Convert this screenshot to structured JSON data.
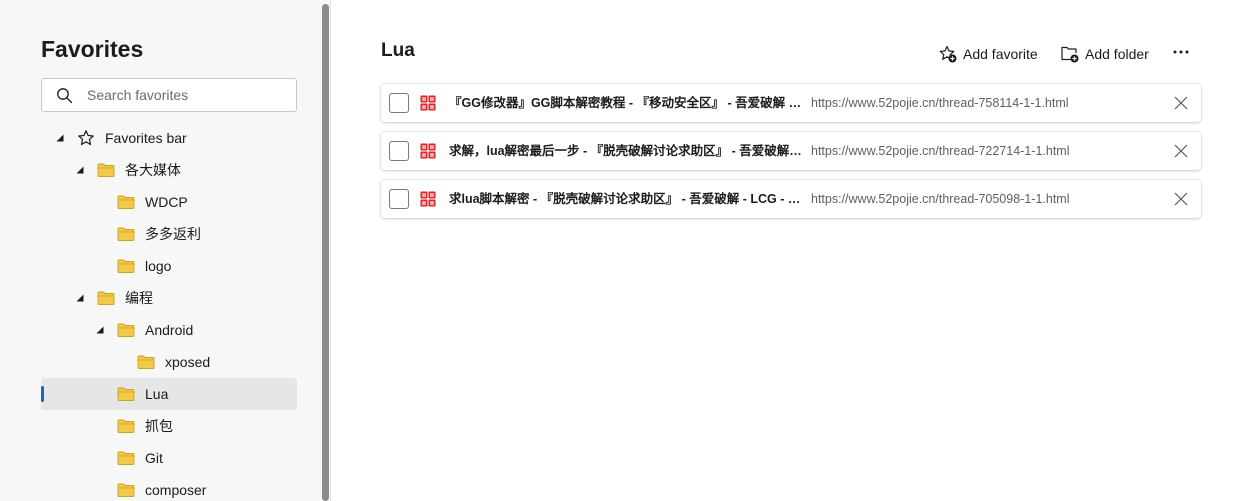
{
  "sidebar": {
    "title": "Favorites",
    "search": {
      "placeholder": "Search favorites",
      "value": ""
    },
    "tree": [
      {
        "label": "Favorites bar",
        "icon": "star-icon",
        "expanded": true,
        "depth": 0
      },
      {
        "label": "各大媒体",
        "icon": "folder-icon",
        "expanded": true,
        "depth": 1
      },
      {
        "label": "WDCP",
        "icon": "folder-icon",
        "depth": 2
      },
      {
        "label": "多多返利",
        "icon": "folder-icon",
        "depth": 2
      },
      {
        "label": "logo",
        "icon": "folder-icon",
        "depth": 2
      },
      {
        "label": "编程",
        "icon": "folder-icon",
        "expanded": true,
        "depth": 1
      },
      {
        "label": "Android",
        "icon": "folder-icon",
        "expanded": true,
        "depth": 2
      },
      {
        "label": "xposed",
        "icon": "folder-icon",
        "depth": 3
      },
      {
        "label": "Lua",
        "icon": "folder-icon",
        "depth": 2,
        "selected": true
      },
      {
        "label": "抓包",
        "icon": "folder-icon",
        "depth": 2
      },
      {
        "label": "Git",
        "icon": "folder-icon",
        "depth": 2
      },
      {
        "label": "composer",
        "icon": "folder-icon",
        "depth": 2
      }
    ]
  },
  "main": {
    "title": "Lua",
    "toolbar": {
      "add_favorite": "Add favorite",
      "add_folder": "Add folder",
      "more": "More options"
    },
    "items": [
      {
        "title": "『GG修改器』GG脚本解密教程 - 『移动安全区』 - 吾爱破解 - LC...",
        "url": "https://www.52pojie.cn/thread-758114-1-1.html"
      },
      {
        "title": "求解，lua解密最后一步 - 『脱壳破解讨论求助区』 - 吾爱破解 - L...",
        "url": "https://www.52pojie.cn/thread-722714-1-1.html"
      },
      {
        "title": "求lua脚本解密 - 『脱壳破解讨论求助区』 - 吾爱破解 - LCG - LSG...",
        "url": "https://www.52pojie.cn/thread-705098-1-1.html"
      }
    ]
  },
  "colors": {
    "accent": "#0f6cbd",
    "folder": "#f3c94a",
    "favicon": "#d8262b",
    "sidebar_bg": "#f7f7f7",
    "selected_bg": "#e6e6e6"
  }
}
